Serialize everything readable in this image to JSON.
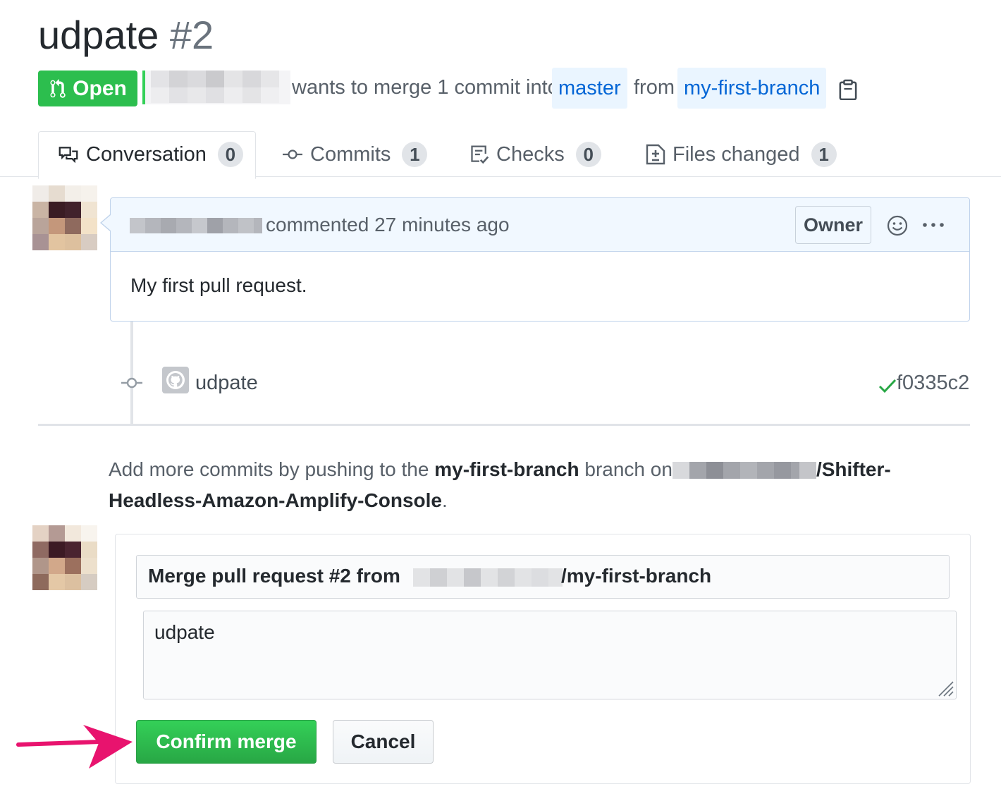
{
  "pr": {
    "title": "udpate",
    "number": "#2",
    "state": "Open",
    "meta_text": "wants to merge 1 commit into",
    "base_branch": "master",
    "from_text": "from",
    "head_branch": "my-first-branch"
  },
  "tabs": [
    {
      "label": "Conversation",
      "count": "0",
      "icon": "conversation-icon"
    },
    {
      "label": "Commits",
      "count": "1",
      "icon": "commit-icon"
    },
    {
      "label": "Checks",
      "count": "0",
      "icon": "checklist-icon"
    },
    {
      "label": "Files changed",
      "count": "1",
      "icon": "diff-icon"
    }
  ],
  "comment": {
    "action": "commented",
    "time": "27 minutes ago",
    "role_badge": "Owner",
    "body": "My first pull request."
  },
  "commit": {
    "message": "udpate",
    "sha": "f0335c2",
    "status": "success"
  },
  "hint": {
    "prefix": "Add more commits by pushing to the",
    "branch": "my-first-branch",
    "middle": "branch on",
    "repo_part1": "/Shifter-",
    "repo_part2": "Headless-Amazon-Amplify-Console",
    "suffix": "."
  },
  "merge": {
    "title_prefix": "Merge pull request #2 from",
    "title_suffix": "/my-first-branch",
    "message": "udpate",
    "confirm_label": "Confirm merge",
    "cancel_label": "Cancel"
  },
  "colors": {
    "open_green": "#2cbe4e",
    "link_blue": "#0366d6",
    "branch_bg": "#eaf5ff",
    "comment_header_bg": "#f1f8ff",
    "annotation_arrow": "#e8136e"
  }
}
